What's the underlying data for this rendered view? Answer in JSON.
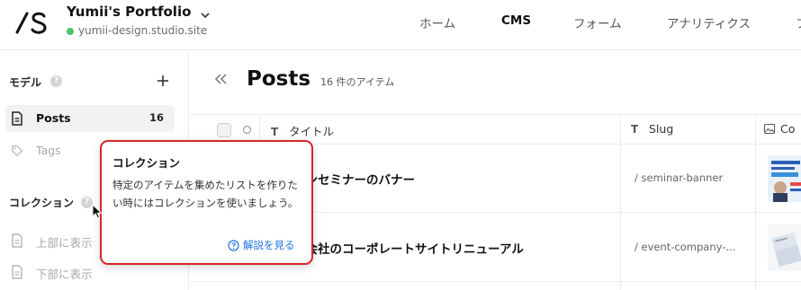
{
  "header": {
    "site_title": "Yumii's Portfolio",
    "site_url": "yumii-design.studio.site",
    "status_color": "#4cc36f",
    "tabs": [
      {
        "label": "ホーム",
        "active": false
      },
      {
        "label": "CMS",
        "active": true
      },
      {
        "label": "フォーム",
        "active": false
      },
      {
        "label": "アナリティクス",
        "active": false
      },
      {
        "label": "フ",
        "active": false
      }
    ]
  },
  "sidebar": {
    "models_heading": "モデル",
    "models": [
      {
        "label": "Posts",
        "count": "16",
        "selected": true,
        "icon": "document-icon"
      },
      {
        "label": "Tags",
        "count": "",
        "selected": false,
        "icon": "tag-icon"
      }
    ],
    "collections_heading": "コレクション",
    "collections": [
      {
        "label": "上部に表示",
        "icon": "document-icon"
      },
      {
        "label": "下部に表示",
        "icon": "document-icon"
      }
    ]
  },
  "main": {
    "title": "Posts",
    "item_count": "16 件のアイテム",
    "columns": {
      "title": "タイトル",
      "slug": "Slug",
      "cover": "Co"
    },
    "rows": [
      {
        "title": "インセミナーのバナー",
        "slug": "/ seminar-banner"
      },
      {
        "title": "ト会社のコーポレートサイトリニューアル",
        "slug": "/ event-company-..."
      }
    ]
  },
  "tooltip": {
    "title": "コレクション",
    "body": "特定のアイテムを集めたリストを作りたい時にはコレクションを使いましょう。",
    "link": "解説を見る",
    "border_color": "#d8232a",
    "link_color": "#1a73e8"
  }
}
